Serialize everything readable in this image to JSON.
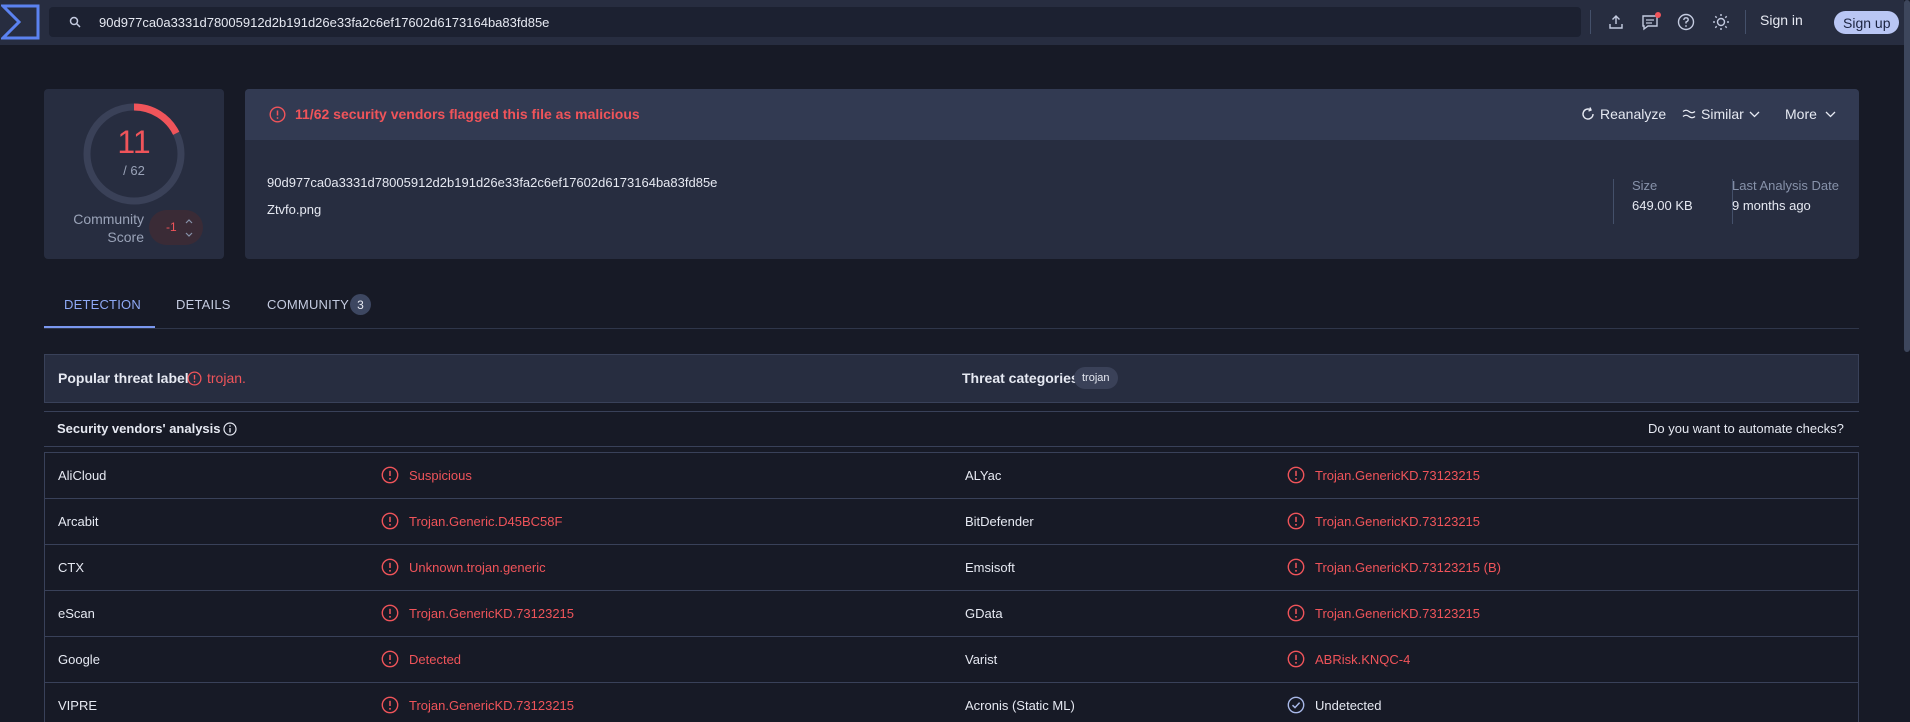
{
  "search": {
    "query": "90d977ca0a3331d78005912d2b191d26e33fa2c6ef17602d6173164ba83fd85e"
  },
  "header": {
    "sign_in": "Sign in",
    "sign_up": "Sign up"
  },
  "score": {
    "detections": "11",
    "total": "/ 62",
    "community_label_1": "Community",
    "community_label_2": "Score",
    "community_value": "-1"
  },
  "summary": {
    "alert": "11/62 security vendors flagged this file as malicious",
    "actions": {
      "reanalyze": "Reanalyze",
      "similar": "Similar",
      "more": "More"
    },
    "hash": "90d977ca0a3331d78005912d2b191d26e33fa2c6ef17602d6173164ba83fd85e",
    "filename": "Ztvfo.png",
    "size_label": "Size",
    "size_value": "649.00 KB",
    "date_label": "Last Analysis Date",
    "date_value": "9 months ago"
  },
  "tabs": {
    "detection": "DETECTION",
    "details": "DETAILS",
    "community": "COMMUNITY",
    "community_count": "3"
  },
  "threat": {
    "popular_label": "Popular threat label",
    "popular_value": "trojan.",
    "categories_label": "Threat categories",
    "category": "trojan"
  },
  "vendors": {
    "title": "Security vendors' analysis",
    "automate": "Do you want to automate checks?",
    "rows": [
      {
        "left_name": "AliCloud",
        "left_result": "Suspicious",
        "right_name": "ALYac",
        "right_result": "Trojan.GenericKD.73123215"
      },
      {
        "left_name": "Arcabit",
        "left_result": "Trojan.Generic.D45BC58F",
        "right_name": "BitDefender",
        "right_result": "Trojan.GenericKD.73123215"
      },
      {
        "left_name": "CTX",
        "left_result": "Unknown.trojan.generic",
        "right_name": "Emsisoft",
        "right_result": "Trojan.GenericKD.73123215 (B)"
      },
      {
        "left_name": "eScan",
        "left_result": "Trojan.GenericKD.73123215",
        "right_name": "GData",
        "right_result": "Trojan.GenericKD.73123215"
      },
      {
        "left_name": "Google",
        "left_result": "Detected",
        "right_name": "Varist",
        "right_result": "ABRisk.KNQC-4"
      },
      {
        "left_name": "VIPRE",
        "left_result": "Trojan.GenericKD.73123215",
        "right_name": "Acronis (Static ML)",
        "right_result": "Undetected"
      }
    ]
  },
  "colors": {
    "malicious": "#f0545a",
    "accent": "#8ea9f5",
    "panel": "#272d40",
    "background": "#171a26"
  },
  "icons": [
    "logo-icon",
    "search-icon",
    "upload-icon",
    "chat-icon",
    "help-icon",
    "theme-icon",
    "alert-icon",
    "refresh-icon",
    "similar-icon",
    "chevron-down-icon",
    "info-icon",
    "check-circle-icon"
  ]
}
